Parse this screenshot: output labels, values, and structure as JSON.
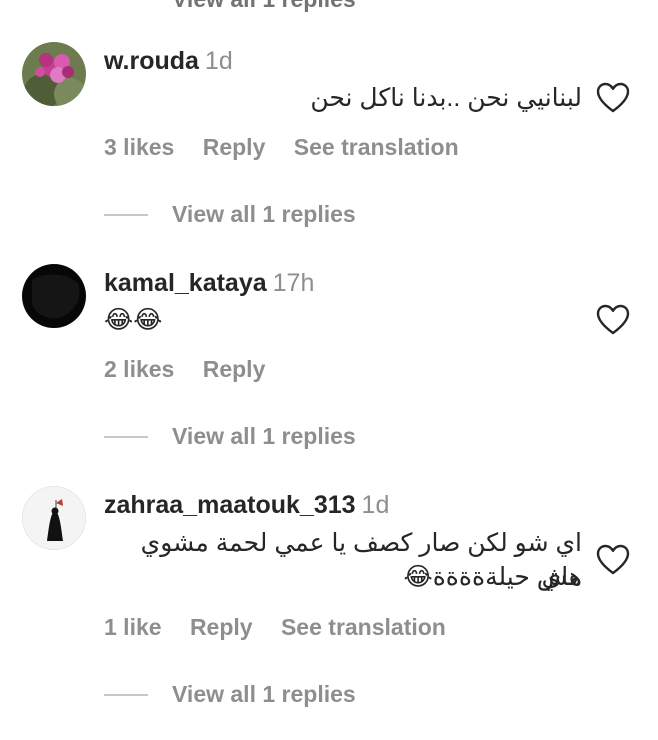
{
  "top_stub": {
    "text": "View all 1 replies"
  },
  "comments": [
    {
      "username": "w.rouda",
      "time": "1d",
      "text": "لبنانيي نحن ..بدنا ناكل نحن",
      "likes": "3 likes",
      "reply_label": "Reply",
      "translation_label": "See translation",
      "view_replies": "View all 1 replies"
    },
    {
      "username": "kamal_kataya",
      "time": "17h",
      "text": "😂😂",
      "likes": "2 likes",
      "reply_label": "Reply",
      "view_replies": "View all 1 replies"
    },
    {
      "username": "zahraa_maatouk_313",
      "time": "1d",
      "text_line1": "اي شو لكن صار كصف يا عمي لحمة مشوي هاي",
      "text_line2": "مش حيلةةةةة😂",
      "likes": "1 like",
      "reply_label": "Reply",
      "translation_label": "See translation",
      "view_replies": "View all 1 replies"
    }
  ],
  "icons": {
    "heart": "heart-outline-icon",
    "emoji": "face-with-tears-of-joy-icon"
  },
  "colors": {
    "primary_text": "#262626",
    "secondary_text": "#8e8e8e",
    "divider": "#c7c7c7"
  }
}
